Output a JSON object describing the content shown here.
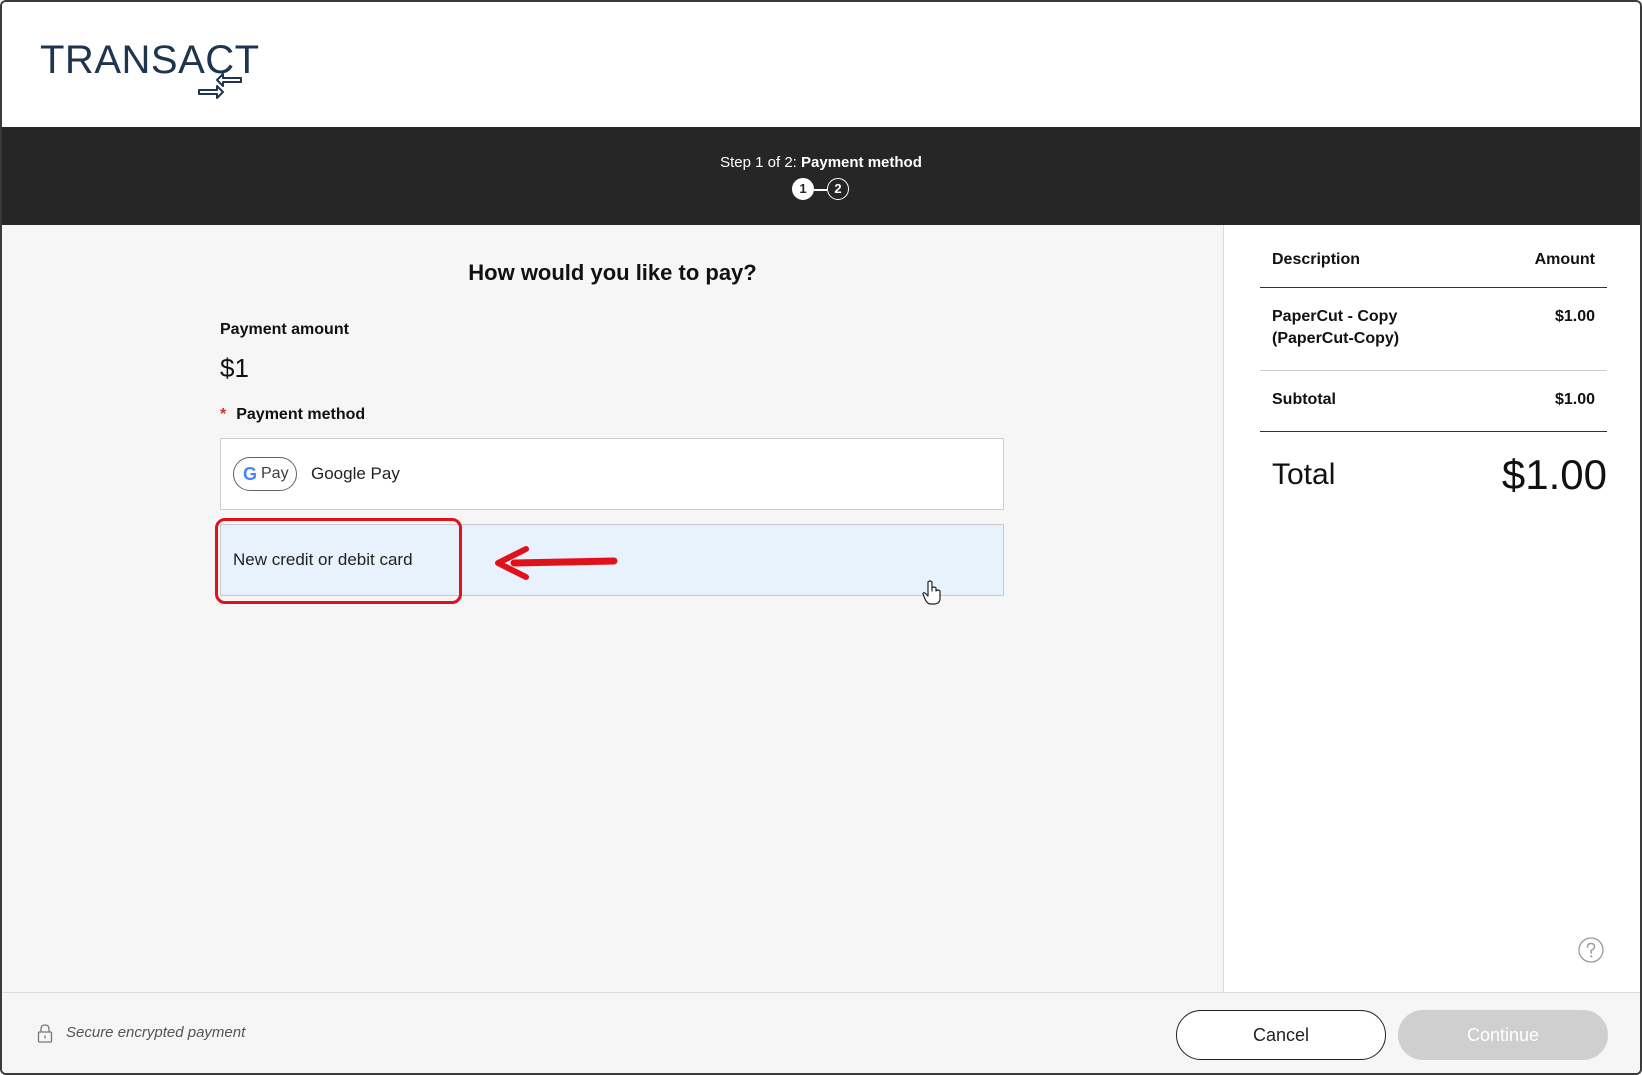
{
  "brand": {
    "logo_text": "TRANSACT"
  },
  "stepbar": {
    "prefix": "Step 1 of 2:",
    "current": "Payment method",
    "steps": [
      "1",
      "2"
    ],
    "active_step": 1
  },
  "main": {
    "question": "How would you like to pay?",
    "payment_amount_label": "Payment amount",
    "payment_amount_value": "$1",
    "payment_method_required": "*",
    "payment_method_label": "Payment method",
    "options": [
      {
        "badge_g": "G",
        "badge_pay": "Pay",
        "label": "Google Pay"
      },
      {
        "label": "New credit or debit card",
        "state": "hovered"
      }
    ]
  },
  "summary": {
    "col_description": "Description",
    "col_amount": "Amount",
    "item_line1": "PaperCut - Copy",
    "item_line2": "(PaperCut-Copy)",
    "item_amount": "$1.00",
    "subtotal_label": "Subtotal",
    "subtotal_value": "$1.00",
    "total_label": "Total",
    "total_value": "$1.00"
  },
  "footer": {
    "secure_text": "Secure encrypted payment",
    "cancel_label": "Cancel",
    "continue_label": "Continue"
  },
  "colors": {
    "stepbar_bg": "#262626",
    "brand_navy": "#1e3550",
    "annotation_red": "#e0111b",
    "selected_option_bg": "#e8f2fc",
    "continue_disabled": "#cfcfcf"
  },
  "icons": [
    "transact-arrows-icon",
    "google-pay-icon",
    "lock-icon",
    "help-icon",
    "hand-cursor-icon",
    "annotation-arrow-icon"
  ]
}
